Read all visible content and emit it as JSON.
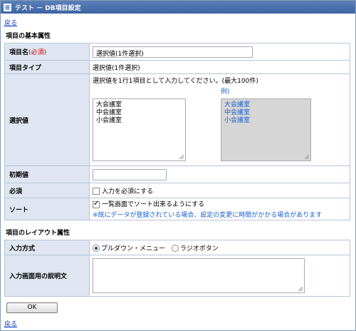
{
  "window": {
    "title": "テスト － DB項目設定"
  },
  "nav": {
    "back_label": "戻る"
  },
  "basic": {
    "heading": "項目の基本属性",
    "item_name": {
      "label": "項目名",
      "required_mark": "(必須)",
      "value": "選択値(1件選択)"
    },
    "item_type": {
      "label": "項目タイプ",
      "value": "選択値(1件選択)"
    },
    "choices": {
      "label": "選択値",
      "instruction": "選択値を1行1項目として入力してください。(最大100件)",
      "lines": [
        "大会議室",
        "中会議室",
        "小会議室"
      ],
      "example_label": "例)",
      "example_lines": [
        "大会議室",
        "中会議室",
        "小会議室"
      ]
    },
    "initial": {
      "label": "初期値",
      "value": ""
    },
    "required": {
      "label": "必須",
      "option": "入力を必須にする",
      "checked": false
    },
    "sort": {
      "label": "ソート",
      "option": "一覧画面でソート出来るようにする",
      "checked": true,
      "note": "※既にデータが登録されている場合、設定の変更に時間がかかる場合があります"
    }
  },
  "layout": {
    "heading": "項目のレイアウト属性",
    "input_method": {
      "label": "入力方式",
      "options": [
        "プルダウン・メニュー",
        "ラジオボタン"
      ],
      "selected": "プルダウン・メニュー"
    },
    "description": {
      "label": "入力画面用の説明文",
      "value": ""
    }
  },
  "actions": {
    "ok_label": "OK"
  },
  "colors": {
    "title_bar": "#3d64a3",
    "label_bg": "#dfe6f1",
    "link": "#0033cc",
    "required": "#cc0000",
    "note": "#1a5fd0"
  }
}
